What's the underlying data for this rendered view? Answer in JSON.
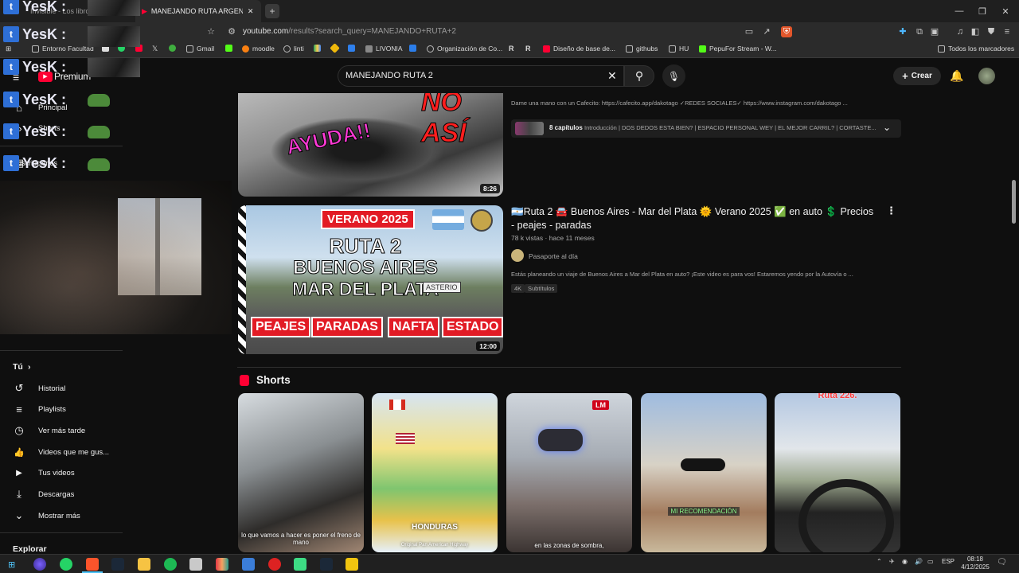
{
  "browser": {
    "tabs": [
      {
        "label": "Invisible - Los libros c",
        "active": false
      },
      {
        "label": "MANEJANDO RUTA ARGENTINA",
        "active": true
      }
    ],
    "url_host": "youtube.com",
    "url_path": "/results?search_query=MANEJANDO+RUTA+2",
    "bookmarks": [
      "Entorno Facultad",
      "Gmail",
      "moodle",
      "linti",
      "LIVONIA",
      "Organización de Co...",
      "Diseño de base de...",
      "githubs",
      "HU",
      "PepuFor Stream - W..."
    ],
    "all_bookmarks": "Todos los marcadores"
  },
  "youtube": {
    "logo_text": "Premium",
    "search_query": "MANEJANDO RUTA 2",
    "create_label": "Crear"
  },
  "sidebar": {
    "top_items": [
      {
        "label": "Principal",
        "icon": "home-icon"
      },
      {
        "label": "Shorts",
        "icon": "shorts-icon"
      },
      {
        "label": "Suscripciones",
        "icon": "subscriptions-icon"
      }
    ],
    "you_header": "Tú",
    "items": [
      {
        "label": "Historial",
        "icon": "history-icon",
        "glyph": "↺"
      },
      {
        "label": "Playlists",
        "icon": "playlists-icon",
        "glyph": "≡"
      },
      {
        "label": "Ver más tarde",
        "icon": "clock-icon",
        "glyph": "◷"
      },
      {
        "label": "Videos que me gus...",
        "icon": "thumbs-up-icon",
        "glyph": "👍"
      },
      {
        "label": "Tus videos",
        "icon": "play-box-icon",
        "glyph": "▶"
      },
      {
        "label": "Descargas",
        "icon": "download-icon",
        "glyph": "⤓"
      },
      {
        "label": "Mostrar más",
        "icon": "chevron-down-icon",
        "glyph": "⌄"
      }
    ],
    "explore_header": "Explorar"
  },
  "overlay": {
    "brand": "YesK :"
  },
  "videos": [
    {
      "thumb_text_1": "NO ASÍ",
      "thumb_text_2": "AYUDA!!",
      "duration": "8:26",
      "description": "Dame una mano con un Cafecito: https://cafecito.app/dakotago ✓REDES SOCIALES✓ https://www.instagram.com/dakotago ...",
      "chapters_count": "8 capítulos",
      "chapters_text": "Introducción | DOS DEDOS ESTA BIEN? | ESPACIO PERSONAL WEY | EL MEJOR CARRIL? | CORTASTE..."
    },
    {
      "title": "🇦🇷Ruta 2 🚘 Buenos Aires - Mar del Plata 🌞 Verano 2025 ✅ en auto 💲 Precios - peajes - paradas",
      "views": "78 k vistas · hace 11 meses",
      "channel": "Pasaporte al día",
      "description": "Estás planeando un viaje de Buenos Aires a Mar del Plata en auto? ¡Este video es para vos! Estaremos yendo por la Autovía o ...",
      "badges": [
        "4K",
        "Subtítulos"
      ],
      "duration": "12:00",
      "thumb": {
        "banner": "VERANO 2025",
        "line1": "RUTA 2",
        "line2": "BUENOS AIRES",
        "line3": "MAR DEL PLATA",
        "tags": [
          "PEAJES",
          "PARADAS",
          "NAFTA",
          "ESTADO"
        ],
        "sign": "ASTERIO"
      }
    }
  ],
  "shorts": {
    "title": "Shorts",
    "items": [
      {
        "caption": "lo que vamos a hacer es poner el freno de mano"
      },
      {
        "caption": "HONDURAS",
        "sub": "Original Pan American Highway"
      },
      {
        "caption": "en las zonas de sombra,",
        "logo": "LM"
      },
      {
        "caption": "MI RECOMENDACIÓN"
      },
      {
        "caption": "Ruta 226."
      }
    ]
  },
  "taskbar": {
    "lang": "ESP",
    "time": "08:18",
    "date": "4/12/2025"
  }
}
